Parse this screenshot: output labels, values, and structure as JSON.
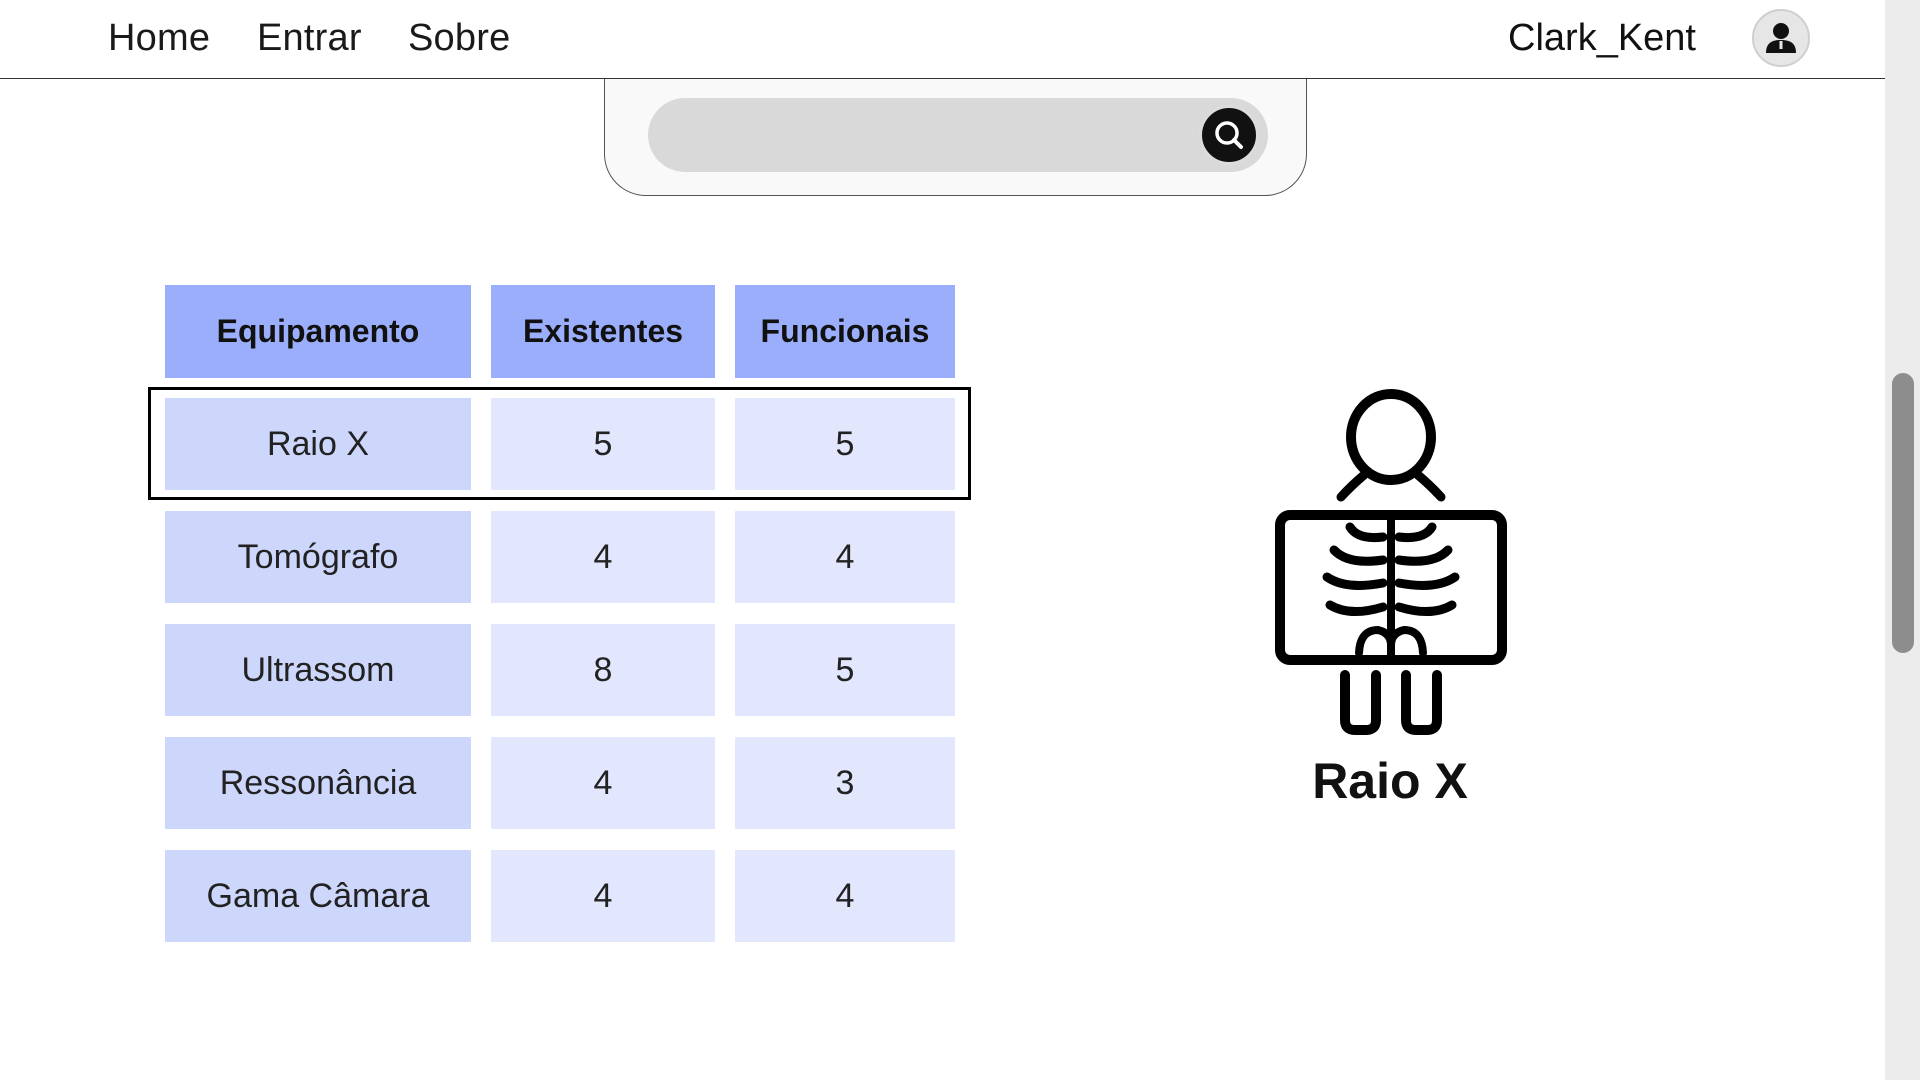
{
  "nav": {
    "links": [
      {
        "label": "Home"
      },
      {
        "label": "Entrar"
      },
      {
        "label": "Sobre"
      }
    ],
    "username": "Clark_Kent",
    "avatar_icon": "user-icon"
  },
  "search": {
    "value": "",
    "placeholder": "",
    "button_icon": "search-icon"
  },
  "table": {
    "headers": [
      "Equipamento",
      "Existentes",
      "Funcionais"
    ],
    "rows": [
      {
        "equipamento": "Raio X",
        "existentes": "5",
        "funcionais": "5"
      },
      {
        "equipamento": "Tomógrafo",
        "existentes": "4",
        "funcionais": "4"
      },
      {
        "equipamento": "Ultrassom",
        "existentes": "8",
        "funcionais": "5"
      },
      {
        "equipamento": "Ressonância",
        "existentes": "4",
        "funcionais": "3"
      },
      {
        "equipamento": "Gama Câmara",
        "existentes": "4",
        "funcionais": "4"
      }
    ],
    "selected_row": 0
  },
  "preview": {
    "icon": "xray-icon",
    "label": "Raio X"
  },
  "colors": {
    "header_bg": "#9aaefb",
    "first_col_bg": "#cdd6fb",
    "other_col_bg": "#e3e7fd",
    "search_field_bg": "#d9d9d9"
  }
}
